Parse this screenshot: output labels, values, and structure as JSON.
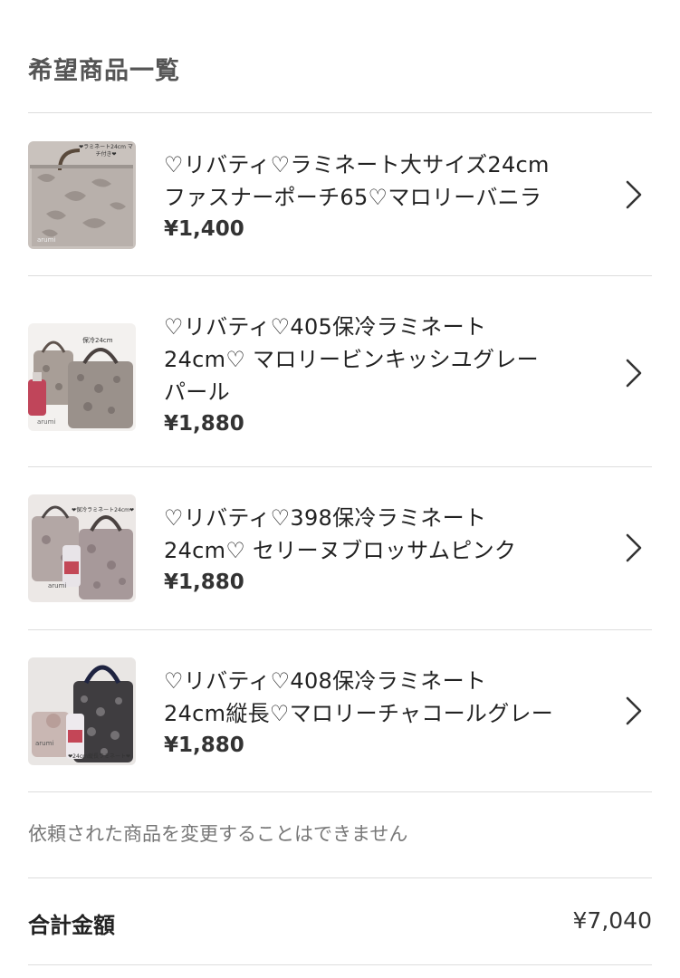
{
  "section_title": "希望商品一覧",
  "items": [
    {
      "name_line1": "♡リバティ♡ラミネート大サイズ24cm",
      "name_line2": "ファスナーポーチ65♡マロリーバニラ",
      "name_line3": "",
      "price": "¥1,400",
      "thumb_tag": "❤ラミネート24cm マチ付き❤",
      "thumb_watermark": "arumi"
    },
    {
      "name_line1": "♡リバティ♡405保冷ラミネート",
      "name_line2": "24cm♡ マロリービンキッシユグレー",
      "name_line3": "パール",
      "price": "¥1,880",
      "thumb_tag": "保冷24cm",
      "thumb_watermark": "arumi"
    },
    {
      "name_line1": "♡リバティ♡398保冷ラミネート",
      "name_line2": "24cm♡ セリーヌブロッサムピンク",
      "name_line3": "",
      "price": "¥1,880",
      "thumb_tag": "❤保冷ラミネート24cm❤",
      "thumb_watermark": "arumi"
    },
    {
      "name_line1": "♡リバティ♡408保冷ラミネート",
      "name_line2": "24cm縦長♡マロリーチャコールグレー",
      "name_line3": "",
      "price": "¥1,880",
      "thumb_tag": "❤24cm縦長ラミネート❤",
      "thumb_watermark": "arumi"
    }
  ],
  "notice": "依頼された商品を変更することはできません",
  "total": {
    "label": "合計金額",
    "value": "¥7,040"
  },
  "icons": {
    "chevron": "chevron-right-icon"
  },
  "colors": {
    "divider": "#dddddd",
    "muted_text": "#777777",
    "title_text": "#555555"
  }
}
